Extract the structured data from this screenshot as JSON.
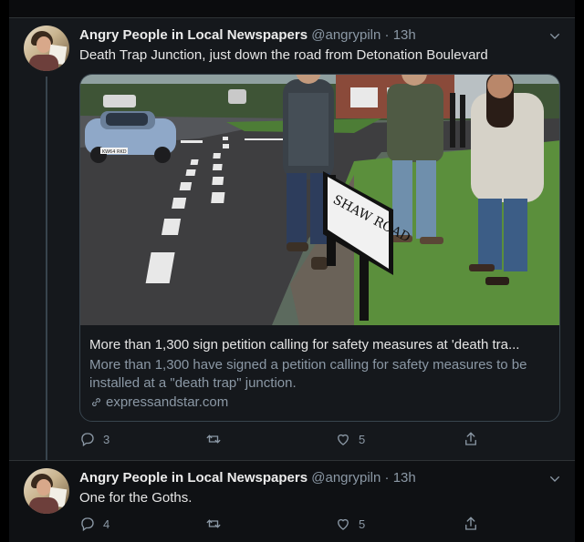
{
  "tweets": [
    {
      "author_name": "Angry People in Local Newspapers",
      "handle": "@angrypiln",
      "separator": "·",
      "time": "13h",
      "text": "Death Trap Junction, just down the road from Detonation Boulevard",
      "card": {
        "title": "More than 1,300 sign petition calling for safety measures at 'death tra...",
        "description": "More than 1,300 have signed a petition calling for safety measures to be installed at a \"death trap\" junction.",
        "domain": "expressandstar.com",
        "sign_text": "SHAW ROAD",
        "car_plate": "KW64 RKD"
      },
      "replies": "3",
      "retweets": "",
      "likes": "5"
    },
    {
      "author_name": "Angry People in Local Newspapers",
      "handle": "@angrypiln",
      "separator": "·",
      "time": "13h",
      "text": "One for the Goths.",
      "replies": "4",
      "retweets": "",
      "likes": "5"
    }
  ],
  "colors": {
    "background": "#15181c",
    "text_secondary": "#8b98a5",
    "border": "#38444d"
  },
  "icons": [
    "chevron-down-icon",
    "reply-icon",
    "retweet-icon",
    "like-icon",
    "share-icon",
    "link-icon"
  ]
}
